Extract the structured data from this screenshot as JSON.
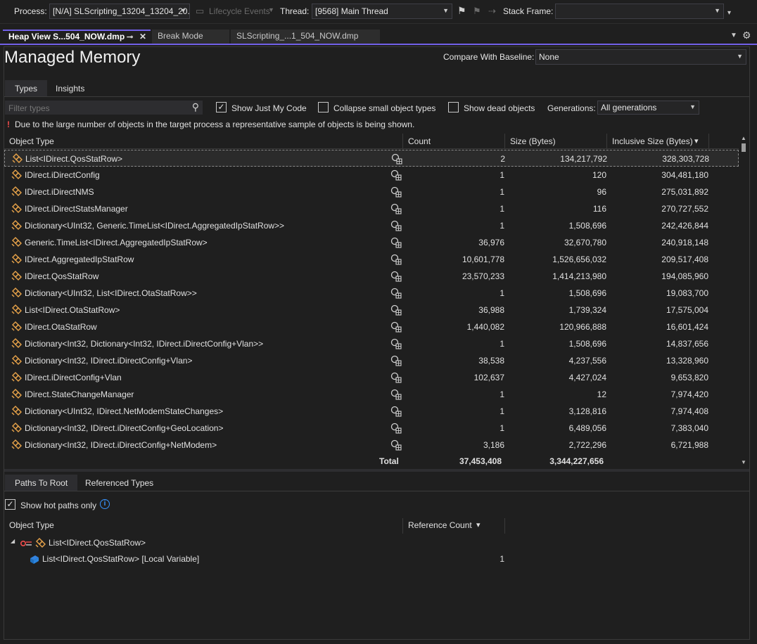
{
  "toolbar": {
    "process_label": "Process:",
    "process_value": "[N/A] SLScripting_13204_13204_20...",
    "lifecycle_label": "Lifecycle Events",
    "thread_label": "Thread:",
    "thread_value": "[9568] Main Thread",
    "stack_frame_label": "Stack Frame:",
    "stack_frame_value": ""
  },
  "doc_tabs": [
    {
      "label": "Heap View S...504_NOW.dmp",
      "pin": "⊸",
      "close": "✕"
    },
    {
      "label": "Break Mode"
    },
    {
      "label": "SLScripting_...1_504_NOW.dmp"
    }
  ],
  "page": {
    "title": "Managed Memory",
    "compare_label": "Compare With Baseline:",
    "compare_value": "None"
  },
  "view_tabs": [
    "Types",
    "Insights"
  ],
  "filter": {
    "placeholder": "Filter types",
    "show_just_my_code": "Show Just My Code",
    "show_just_my_code_checked": true,
    "collapse_small": "Collapse small object types",
    "collapse_small_checked": false,
    "show_dead": "Show dead objects",
    "show_dead_checked": false,
    "generations_label": "Generations:",
    "generations_value": "All generations"
  },
  "warning": {
    "mark": "!",
    "text": "Due to the large number of objects in the target process a representative sample of objects is being shown."
  },
  "types_table": {
    "columns": [
      "Object Type",
      "Count",
      "Size (Bytes)",
      "Inclusive Size (Bytes)"
    ],
    "sort_indicator": "▾",
    "rows": [
      {
        "type": "List<IDirect.QosStatRow>",
        "count": "2",
        "size": "134,217,792",
        "inclusive": "328,303,728"
      },
      {
        "type": "IDirect.iDirectConfig",
        "count": "1",
        "size": "120",
        "inclusive": "304,481,180"
      },
      {
        "type": "IDirect.iDirectNMS",
        "count": "1",
        "size": "96",
        "inclusive": "275,031,892"
      },
      {
        "type": "IDirect.iDirectStatsManager",
        "count": "1",
        "size": "116",
        "inclusive": "270,727,552"
      },
      {
        "type": "Dictionary<UInt32, Generic.TimeList<IDirect.AggregatedIpStatRow>>",
        "count": "1",
        "size": "1,508,696",
        "inclusive": "242,426,844"
      },
      {
        "type": "Generic.TimeList<IDirect.AggregatedIpStatRow>",
        "count": "36,976",
        "size": "32,670,780",
        "inclusive": "240,918,148"
      },
      {
        "type": "IDirect.AggregatedIpStatRow",
        "count": "10,601,778",
        "size": "1,526,656,032",
        "inclusive": "209,517,408"
      },
      {
        "type": "IDirect.QosStatRow",
        "count": "23,570,233",
        "size": "1,414,213,980",
        "inclusive": "194,085,960"
      },
      {
        "type": "Dictionary<UInt32, List<IDirect.OtaStatRow>>",
        "count": "1",
        "size": "1,508,696",
        "inclusive": "19,083,700"
      },
      {
        "type": "List<IDirect.OtaStatRow>",
        "count": "36,988",
        "size": "1,739,324",
        "inclusive": "17,575,004"
      },
      {
        "type": "IDirect.OtaStatRow",
        "count": "1,440,082",
        "size": "120,966,888",
        "inclusive": "16,601,424"
      },
      {
        "type": "Dictionary<Int32, Dictionary<Int32, IDirect.iDirectConfig+Vlan>>",
        "count": "1",
        "size": "1,508,696",
        "inclusive": "14,837,656"
      },
      {
        "type": "Dictionary<Int32, IDirect.iDirectConfig+Vlan>",
        "count": "38,538",
        "size": "4,237,556",
        "inclusive": "13,328,960"
      },
      {
        "type": "IDirect.iDirectConfig+Vlan",
        "count": "102,637",
        "size": "4,427,024",
        "inclusive": "9,653,820"
      },
      {
        "type": "IDirect.StateChangeManager",
        "count": "1",
        "size": "12",
        "inclusive": "7,974,420"
      },
      {
        "type": "Dictionary<UInt32, IDirect.NetModemStateChanges>",
        "count": "1",
        "size": "3,128,816",
        "inclusive": "7,974,408"
      },
      {
        "type": "Dictionary<Int32, IDirect.iDirectConfig+GeoLocation>",
        "count": "1",
        "size": "6,489,056",
        "inclusive": "7,383,040"
      },
      {
        "type": "Dictionary<Int32, IDirect.iDirectConfig+NetModem>",
        "count": "3,186",
        "size": "2,722,296",
        "inclusive": "6,721,988"
      }
    ],
    "total_label": "Total",
    "total_count": "37,453,408",
    "total_size": "3,344,227,656"
  },
  "bottom_tabs": [
    "Paths To Root",
    "Referenced Types"
  ],
  "hot_paths": {
    "label": "Show hot paths only",
    "checked": true
  },
  "paths_table": {
    "columns": [
      "Object Type",
      "Reference Count"
    ],
    "sort_indicator": "▾",
    "root": {
      "expander": "◢",
      "type": "List<IDirect.QosStatRow>"
    },
    "child": {
      "type": "List<IDirect.QosStatRow> [Local Variable]",
      "count": "1"
    }
  },
  "colors": {
    "accent": "#7160e8",
    "icon_orange": "#e8a34a",
    "warning_red": "#f14c4c",
    "info_blue": "#3794ff"
  }
}
